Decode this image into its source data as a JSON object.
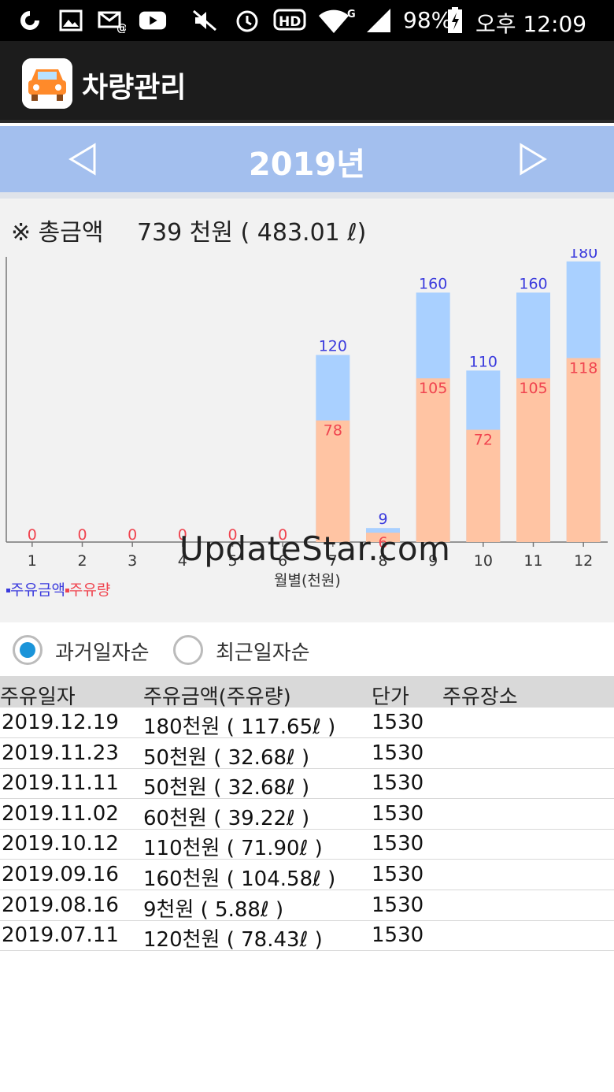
{
  "status_bar": {
    "battery": "98%",
    "time": "오후 12:09",
    "network": "G",
    "icons": [
      "sync-icon",
      "gallery-icon",
      "email-icon",
      "youtube-icon",
      "mute-icon",
      "alarm-icon",
      "hd-icon",
      "wifi-icon",
      "signal-icon",
      "battery-icon"
    ]
  },
  "app_bar": {
    "title": "차량관리",
    "logo_icon": "car-icon"
  },
  "year_nav": {
    "title": "2019년",
    "prev_icon": "triangle-left-icon",
    "next_icon": "triangle-right-icon"
  },
  "total": {
    "label": "※ 총금액",
    "value": "739 천원 ( 483.01 ℓ)"
  },
  "chart_data": {
    "type": "bar",
    "categories": [
      "1",
      "2",
      "3",
      "4",
      "5",
      "6",
      "7",
      "8",
      "9",
      "10",
      "11",
      "12"
    ],
    "series": [
      {
        "name": "주유금액",
        "values": [
          0,
          0,
          0,
          0,
          0,
          0,
          120,
          9,
          160,
          110,
          160,
          180
        ],
        "color": "#a9d0ff",
        "label_color": "#3b3bdd"
      },
      {
        "name": "주유량",
        "values": [
          0,
          0,
          0,
          0,
          0,
          0,
          78,
          6,
          105,
          72,
          105,
          118
        ],
        "color": "#ffc4a3",
        "label_color": "#f0444f"
      }
    ],
    "xlabel": "월별(천원)",
    "ylim": [
      0,
      190
    ],
    "legend": "bottom-left"
  },
  "legend": [
    {
      "label": "주유금액",
      "color": "#3b3bdd"
    },
    {
      "label": "주유량",
      "color": "#f0444f"
    }
  ],
  "watermark": "UpdateStar.com",
  "sort": {
    "options": [
      {
        "label": "과거일자순",
        "selected": true
      },
      {
        "label": "최근일자순",
        "selected": false
      }
    ]
  },
  "table": {
    "headers": [
      "주유일자",
      "주유금액(주유량)",
      "단가",
      "주유장소"
    ],
    "rows": [
      [
        "2019.12.19",
        "180천원 ( 117.65ℓ )",
        "1530",
        ""
      ],
      [
        "2019.11.23",
        "50천원 ( 32.68ℓ )",
        "1530",
        ""
      ],
      [
        "2019.11.11",
        "50천원 ( 32.68ℓ )",
        "1530",
        ""
      ],
      [
        "2019.11.02",
        "60천원 ( 39.22ℓ )",
        "1530",
        ""
      ],
      [
        "2019.10.12",
        "110천원 ( 71.90ℓ )",
        "1530",
        ""
      ],
      [
        "2019.09.16",
        "160천원 ( 104.58ℓ )",
        "1530",
        ""
      ],
      [
        "2019.08.16",
        "9천원 ( 5.88ℓ )",
        "1530",
        ""
      ],
      [
        "2019.07.11",
        "120천원 ( 78.43ℓ )",
        "1530",
        ""
      ]
    ]
  }
}
